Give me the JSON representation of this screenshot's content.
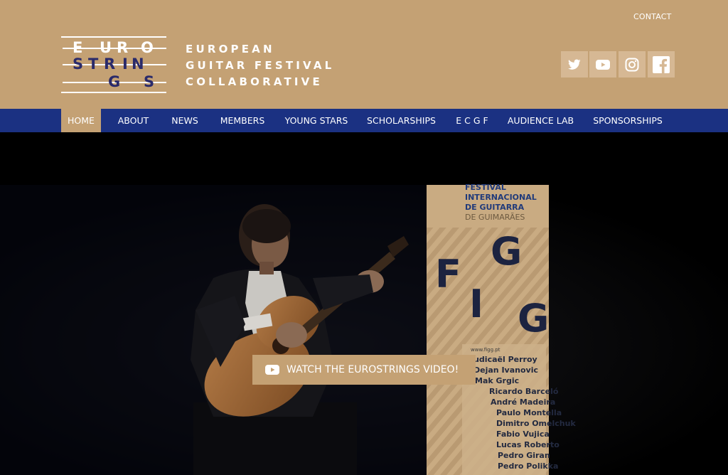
{
  "header": {
    "contact_label": "CONTACT",
    "brand_lines": [
      "EUROPEAN",
      "GUITAR FESTIVAL",
      "COLLABORATIVE"
    ],
    "logo": {
      "row1": [
        "E",
        "U",
        "R",
        "O"
      ],
      "row2": [
        "S",
        "T",
        "R",
        "I",
        "N"
      ],
      "row3": [
        "G",
        "S"
      ]
    }
  },
  "social": [
    {
      "icon": "twitter-icon"
    },
    {
      "icon": "youtube-icon"
    },
    {
      "icon": "instagram-icon"
    },
    {
      "icon": "facebook-icon"
    }
  ],
  "nav": {
    "items": [
      "HOME",
      "ABOUT",
      "NEWS",
      "MEMBERS",
      "YOUNG STARS",
      "SCHOLARSHIPS",
      "E C G F",
      "AUDIENCE LAB",
      "SPONSORSHIPS"
    ],
    "active": "HOME"
  },
  "hero": {
    "banner": {
      "lines": [
        "FESTIVAL",
        "INTERNACIONAL",
        "DE GUITARRA",
        "DE GUIMARÃES"
      ],
      "letters": [
        "F",
        "G",
        "I",
        "G"
      ],
      "url": "www.figg.pt",
      "names": [
        "Judicaël Perroy",
        "Dejan Ivanovic",
        "Mak Grgic",
        "Ricardo Barceló",
        "André Madeira",
        "Paulo Montella",
        "Dimitro Omelchuk",
        "Fabio Vujica",
        "Lucas Roberto",
        "Pedro Giran",
        "Pedro Polikka"
      ]
    },
    "cta_label": "WATCH THE EUROSTRINGS VIDEO!"
  },
  "colors": {
    "header_bg": "#c4a174",
    "nav_bg": "#1b3182",
    "logo_blue": "#2a2a6a",
    "social_bg": "#d6b894"
  }
}
